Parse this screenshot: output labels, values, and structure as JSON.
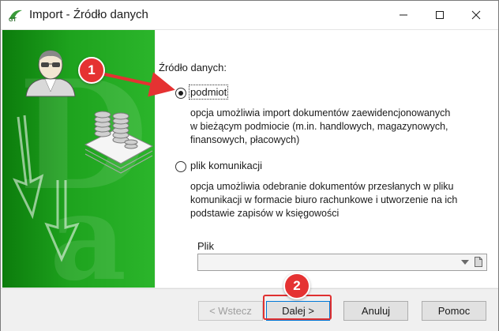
{
  "window": {
    "title": "Import - Źródło danych",
    "controls": {
      "minimize": "minimize-icon",
      "maximize": "maximize-icon",
      "close": "close-icon"
    }
  },
  "content": {
    "section_label": "Źródło danych:",
    "options": [
      {
        "label": "podmiot",
        "selected": true,
        "description": [
          "opcja umożliwia import dokumentów zaewidencjonowanych",
          "w bieżącym podmiocie (m.in. handlowych, magazynowych,",
          "finansowych, płacowych)"
        ]
      },
      {
        "label": "plik komunikacji",
        "selected": false,
        "description": [
          "opcja umożliwia odebranie dokumentów przesłanych w pliku",
          "komunikacji w formacie biuro rachunkowe i utworzenie na ich",
          "podstawie zapisów w księgowości"
        ]
      }
    ],
    "file": {
      "label": "Plik",
      "value": ""
    }
  },
  "buttons": {
    "back": "< Wstecz",
    "next": "Dalej >",
    "cancel": "Anuluj",
    "help": "Pomoc"
  },
  "annotations": {
    "marker_1": "1",
    "marker_2": "2",
    "color": "#e53232"
  },
  "colors": {
    "panel_green_dark": "#0c7c0c",
    "panel_green_light": "#2bb52b",
    "focus_blue": "#0078d7"
  }
}
